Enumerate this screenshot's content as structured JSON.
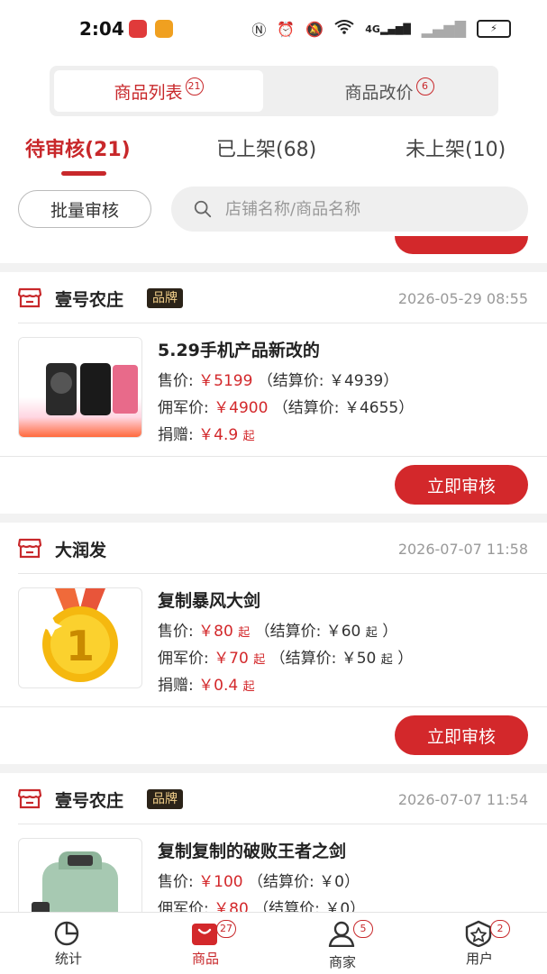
{
  "status_bar": {
    "time": "2:04",
    "network": "4G"
  },
  "segment": {
    "tabs": [
      {
        "label": "商品列表",
        "badge": "21"
      },
      {
        "label": "商品改价",
        "badge": "6"
      }
    ]
  },
  "status_tabs": [
    {
      "label": "待审核(21)"
    },
    {
      "label": "已上架(68)"
    },
    {
      "label": "未上架(10)"
    }
  ],
  "toolbar": {
    "batch_label": "批量审核"
  },
  "search": {
    "placeholder": "店铺名称/商品名称"
  },
  "cards": [
    {
      "store": "壹号农庄",
      "badge": "品牌",
      "time": "2026-05-29 08:55",
      "title": "5.29手机产品新改的",
      "price_label": "售价:",
      "price": "￥5199",
      "price_settle": "（结算价: ￥4939）",
      "army_label": "佣军价:",
      "army": "￥4900",
      "army_settle": "（结算价: ￥4655）",
      "donate_label": "捐赠:",
      "donate": "￥4.9",
      "donate_suffix": "起",
      "button": "立即审核"
    },
    {
      "store": "大润发",
      "time": "2026-07-07 11:58",
      "title": "复制暴风大剑",
      "price_label": "售价:",
      "price": "￥80",
      "price_suffix": "起",
      "price_settle": "（结算价: ￥60",
      "price_settle_suffix": "起",
      "price_settle_end": "）",
      "army_label": "佣军价:",
      "army": "￥70",
      "army_suffix": "起",
      "army_settle": "（结算价: ￥50",
      "army_settle_suffix": "起",
      "army_settle_end": "）",
      "donate_label": "捐赠:",
      "donate": "￥0.4",
      "donate_suffix": "起",
      "button": "立即审核"
    },
    {
      "store": "壹号农庄",
      "badge": "品牌",
      "time": "2026-07-07 11:54",
      "title": "复制复制的破败王者之剑",
      "price_label": "售价:",
      "price": "￥100",
      "price_settle": "（结算价: ￥0）",
      "army_label": "佣军价:",
      "army": "￥80",
      "army_settle": "（结算价: ￥0）"
    }
  ],
  "tabbar": [
    {
      "label": "统计",
      "icon": "pie-chart-icon"
    },
    {
      "label": "商品",
      "icon": "shopping-bag-icon",
      "badge": "27"
    },
    {
      "label": "商家",
      "icon": "merchant-icon",
      "badge": "5"
    },
    {
      "label": "用户",
      "icon": "user-star-icon",
      "badge": "2"
    }
  ],
  "colors": {
    "accent": "#d3282b",
    "brand_badge_bg": "#2b2318",
    "brand_badge_text": "#f2cf8a"
  }
}
